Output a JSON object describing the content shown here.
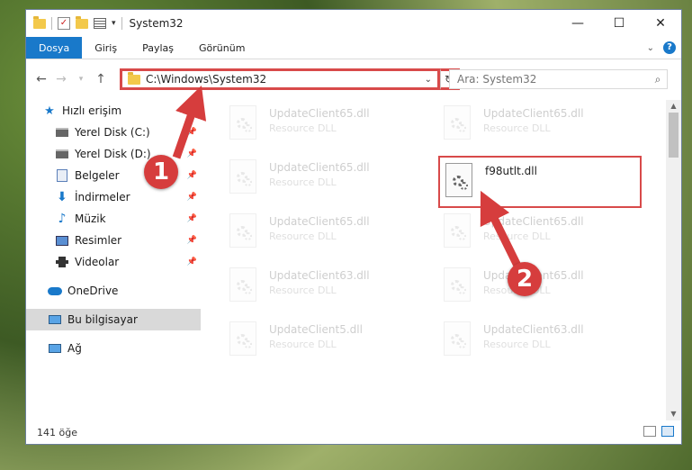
{
  "window": {
    "title": "System32",
    "controls": {
      "minimize": "—",
      "maximize": "☐",
      "close": "✕"
    }
  },
  "ribbon": {
    "tabs": [
      {
        "label": "Dosya",
        "active": true
      },
      {
        "label": "Giriş"
      },
      {
        "label": "Paylaş"
      },
      {
        "label": "Görünüm"
      }
    ]
  },
  "navbar": {
    "address": "C:\\Windows\\System32",
    "search_placeholder": "Ara: System32"
  },
  "sidebar": {
    "items": [
      {
        "label": "Hızlı erişim",
        "icon": "star-icon",
        "pinned": false
      },
      {
        "label": "Yerel Disk (C:)",
        "icon": "drive-icon",
        "pinned": true
      },
      {
        "label": "Yerel Disk (D:)",
        "icon": "drive-icon",
        "pinned": true
      },
      {
        "label": "Belgeler",
        "icon": "documents-icon",
        "pinned": true
      },
      {
        "label": "İndirmeler",
        "icon": "download-icon",
        "pinned": true
      },
      {
        "label": "Müzik",
        "icon": "music-icon",
        "pinned": true
      },
      {
        "label": "Resimler",
        "icon": "pictures-icon",
        "pinned": true
      },
      {
        "label": "Videolar",
        "icon": "videos-icon",
        "pinned": true
      },
      {
        "label": "OneDrive",
        "icon": "onedrive-icon",
        "pinned": false
      },
      {
        "label": "Bu bilgisayar",
        "icon": "this-pc-icon",
        "pinned": false,
        "selected": true
      },
      {
        "label": "Ağ",
        "icon": "network-icon",
        "pinned": false
      }
    ]
  },
  "files": [
    {
      "name": "UpdateClient65.dll",
      "type": "Resource DLL"
    },
    {
      "name": "UpdateClient65.dll",
      "type": "Resource DLL"
    },
    {
      "name": "UpdateClient65.dll",
      "type": "Resource DLL"
    },
    {
      "name": "f98utlt.dll",
      "type": "",
      "highlighted": true
    },
    {
      "name": "UpdateClient65.dll",
      "type": "Resource DLL"
    },
    {
      "name": "UpdateClient65.dll",
      "type": "Resource DLL"
    },
    {
      "name": "UpdateClient63.dll",
      "type": "Resource DLL"
    },
    {
      "name": "UpdateClient65.dll",
      "type": "Resource DLL"
    },
    {
      "name": "UpdateClient5.dll",
      "type": "Resource DLL"
    },
    {
      "name": "UpdateClient63.dll",
      "type": "Resource DLL"
    }
  ],
  "status": {
    "count": "141 öğe"
  },
  "annotations": {
    "step1": "1",
    "step2": "2",
    "color": "#d63d3d"
  }
}
